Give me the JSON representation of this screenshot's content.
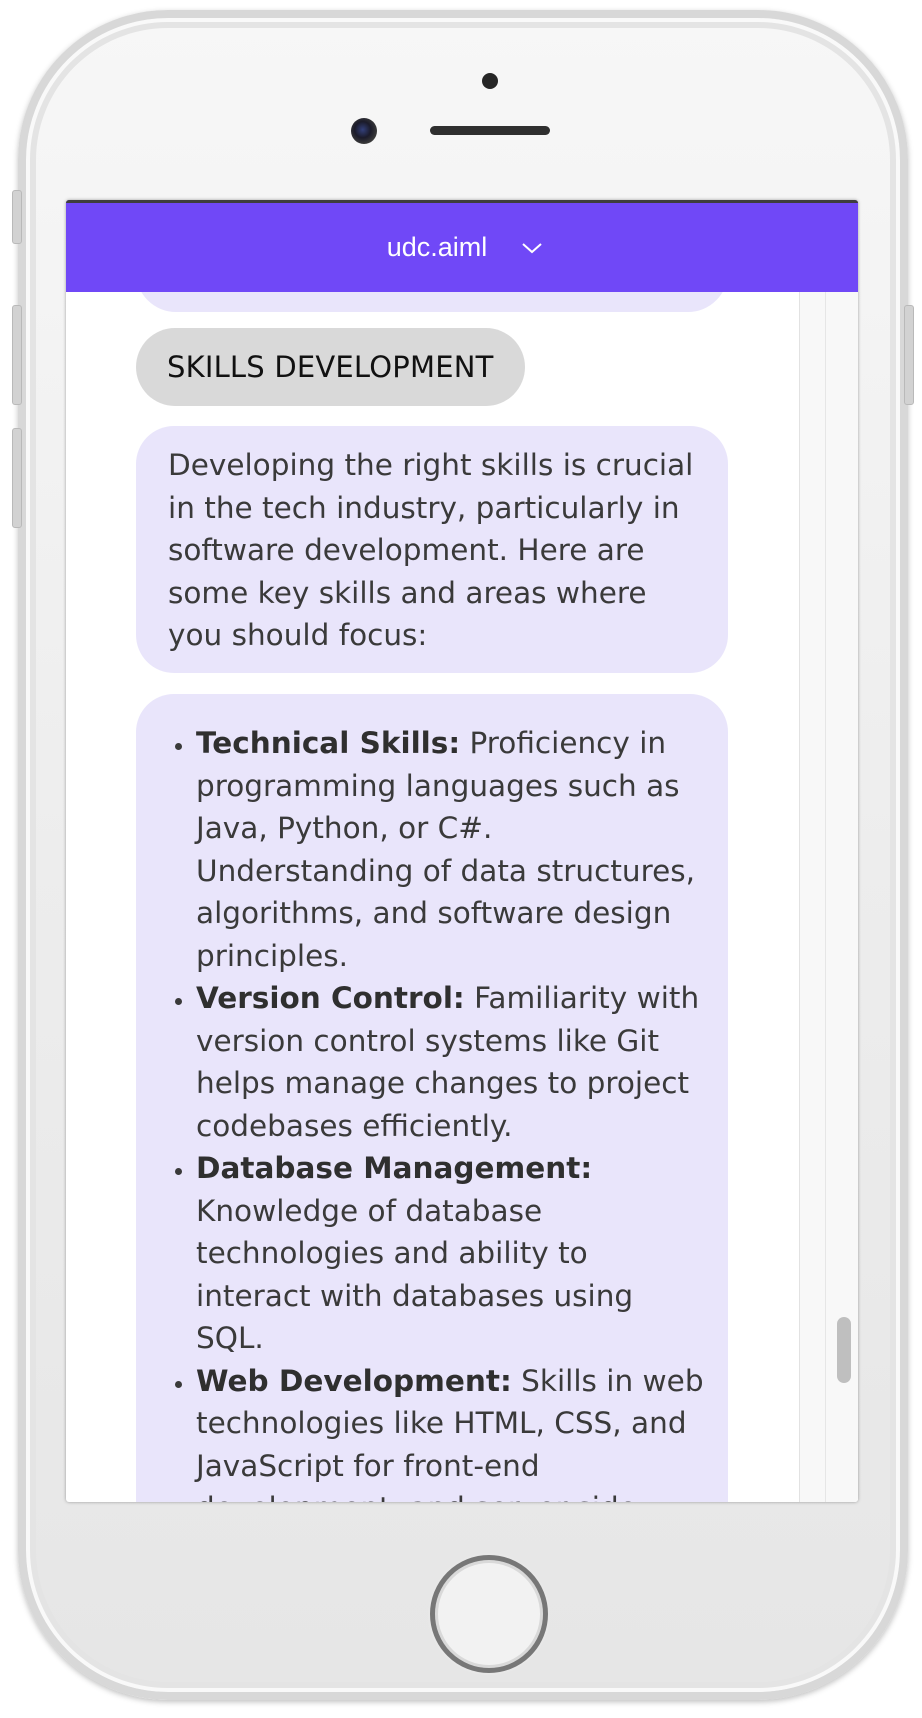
{
  "header": {
    "title": "udc.aiml",
    "accent_color": "#7048f7",
    "dropdown_icon": "chevron-down-icon"
  },
  "chat": {
    "user_message": "SKILLS DEVELOPMENT",
    "bot_intro": "Developing the right skills is crucial in the tech industry, particularly in software development. Here are some key skills and areas where you should focus:",
    "bot_list": [
      {
        "title": "Technical Skills:",
        "text": " Proficiency in programming languages such as Java, Python, or C#. Understanding of data structures, algorithms, and software design principles."
      },
      {
        "title": "Version Control:",
        "text": " Familiarity with version control systems like Git helps manage changes to project codebases efficiently."
      },
      {
        "title": "Database Management:",
        "text": " Knowledge of database technologies and ability to interact with databases using SQL."
      },
      {
        "title": "Web Development:",
        "text": " Skills in web technologies like HTML, CSS, and JavaScript for front-end development, and server-side languages for back-end development."
      }
    ],
    "bubble_color": "#e9e5fb",
    "user_chip_color": "#d9d9d9"
  }
}
